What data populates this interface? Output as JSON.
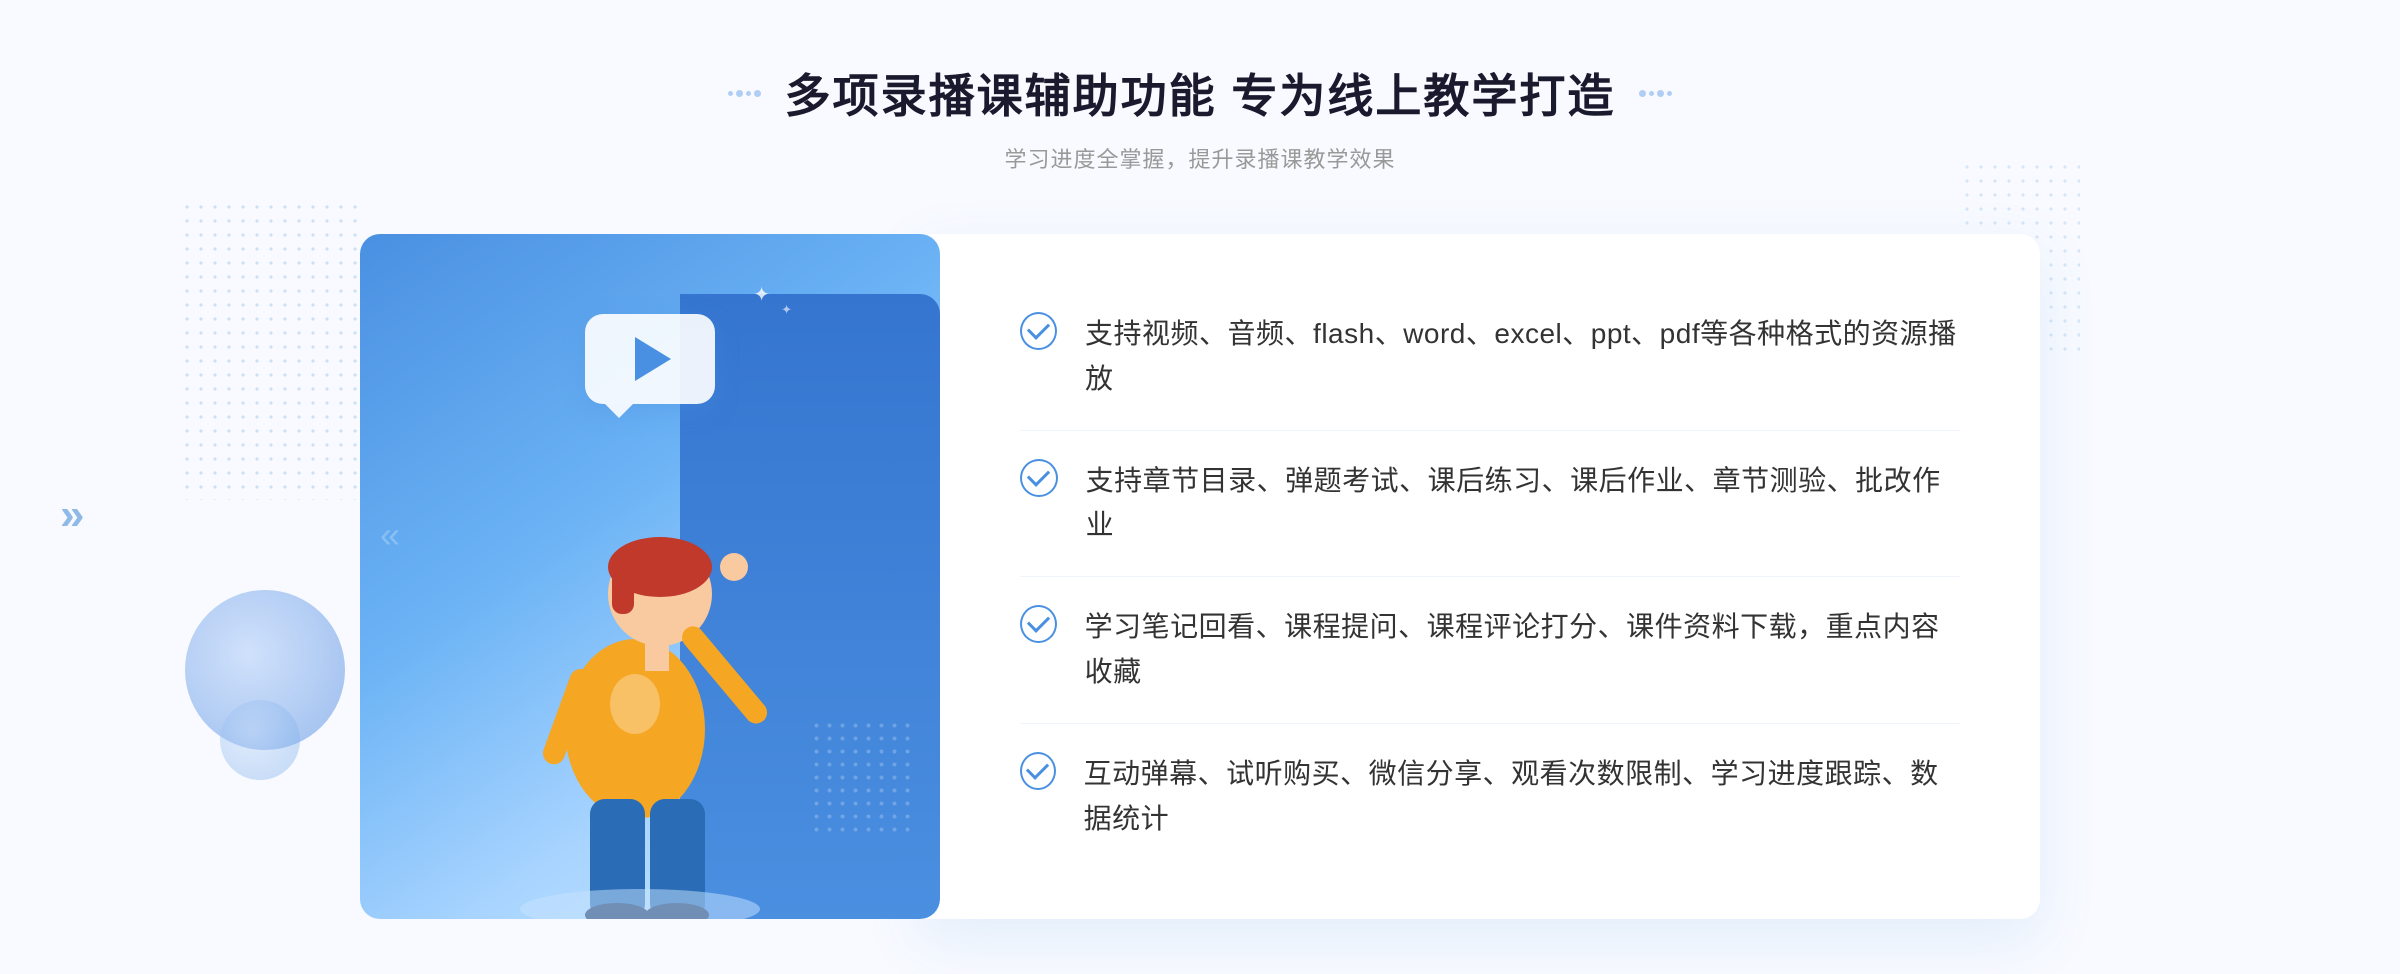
{
  "header": {
    "title": "多项录播课辅助功能 专为线上教学打造",
    "subtitle": "学习进度全掌握，提升录播课教学效果",
    "decorator_dots": [
      "dot1",
      "dot2",
      "dot3",
      "dot4"
    ]
  },
  "features": [
    {
      "id": "feature-1",
      "text": "支持视频、音频、flash、word、excel、ppt、pdf等各种格式的资源播放"
    },
    {
      "id": "feature-2",
      "text": "支持章节目录、弹题考试、课后练习、课后作业、章节测验、批改作业"
    },
    {
      "id": "feature-3",
      "text": "学习笔记回看、课程提问、课程评论打分、课件资料下载，重点内容收藏"
    },
    {
      "id": "feature-4",
      "text": "互动弹幕、试听购买、微信分享、观看次数限制、学习进度跟踪、数据统计"
    }
  ],
  "colors": {
    "blue_primary": "#4a90e2",
    "blue_light": "#6bb3f5",
    "blue_dark": "#3575d0",
    "text_dark": "#1a1a2e",
    "text_gray": "#999999",
    "text_body": "#333333"
  },
  "icons": {
    "play": "▶",
    "check": "✓",
    "chevron_left": "«",
    "sparkle": "✦"
  }
}
